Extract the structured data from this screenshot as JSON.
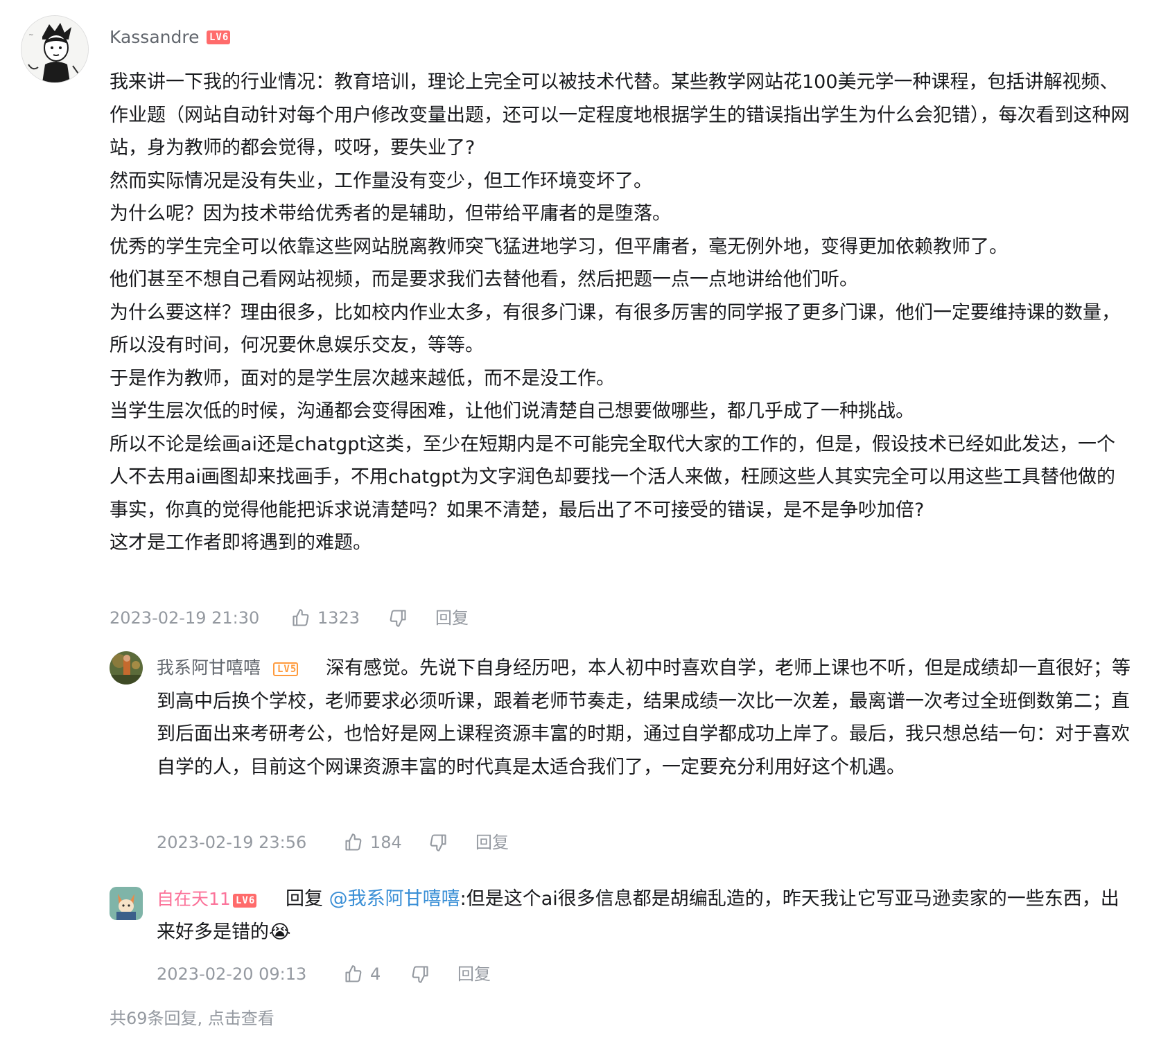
{
  "comments": [
    {
      "user": "Kassandre",
      "level": "LV6",
      "name_color": "#61666d",
      "paragraphs": [
        "我来讲一下我的行业情况：教育培训，理论上完全可以被技术代替。某些教学网站花100美元学一种课程，包括讲解视频、作业题（网站自动针对每个用户修改变量出题，还可以一定程度地根据学生的错误指出学生为什么会犯错），每次看到这种网站，身为教师的都会觉得，哎呀，要失业了?",
        "然而实际情况是没有失业，工作量没有变少，但工作环境变坏了。",
        "为什么呢？因为技术带给优秀者的是辅助，但带给平庸者的是堕落。",
        "优秀的学生完全可以依靠这些网站脱离教师突飞猛进地学习，但平庸者，毫无例外地，变得更加依赖教师了。",
        "他们甚至不想自己看网站视频，而是要求我们去替他看，然后把题一点一点地讲给他们听。",
        "为什么要这样？理由很多，比如校内作业太多，有很多门课，有很多厉害的同学报了更多门课，他们一定要维持课的数量，所以没有时间，何况要休息娱乐交友，等等。",
        "于是作为教师，面对的是学生层次越来越低，而不是没工作。",
        "当学生层次低的时候，沟通都会变得困难，让他们说清楚自己想要做哪些，都几乎成了一种挑战。",
        "所以不论是绘画ai还是chatgpt这类，至少在短期内是不可能完全取代大家的工作的，但是，假设技术已经如此发达，一个人不去用ai画图却来找画手，不用chatgpt为文字润色却要找一个活人来做，枉顾这些人其实完全可以用这些工具替他做的事实，你真的觉得他能把诉求说清楚吗？如果不清楚，最后出了不可接受的错误，是不是争吵加倍?",
        "这才是工作者即将遇到的难题。"
      ],
      "time": "2023-02-19 21:30",
      "likes": "1323",
      "reply_label": "回复"
    },
    {
      "user": "我系阿甘嘻嘻",
      "level": "LV5",
      "name_color": "#61666d",
      "text": "深有感觉。先说下自身经历吧，本人初中时喜欢自学，老师上课也不听，但是成绩却一直很好；等到高中后换个学校，老师要求必须听课，跟着老师节奏走，结果成绩一次比一次差，最离谱一次考过全班倒数第二；直到后面出来考研考公，也恰好是网上课程资源丰富的时期，通过自学都成功上岸了。最后，我只想总结一句：对于喜欢自学的人，目前这个网课资源丰富的时代真是太适合我们了，一定要充分利用好这个机遇。",
      "time": "2023-02-19 23:56",
      "likes": "184",
      "reply_label": "回复"
    },
    {
      "user": "自在天11",
      "level": "LV6",
      "name_color": "#fb7299",
      "reply_prefix": "回复",
      "mention": "@我系阿甘嘻嘻",
      "text": ":但是这个ai很多信息都是胡编乱造的，昨天我让它写亚马逊卖家的一些东西，出来好多是错的",
      "emoji": "😭",
      "time": "2023-02-20 09:13",
      "likes": "4",
      "reply_label": "回复"
    }
  ],
  "footer_text": "共69条回复, 点击查看",
  "colors": {
    "meta": "#9499a0",
    "text": "#18191c",
    "mention": "#3a8fd6",
    "lv6": "#ff6b6b",
    "lv5": "#ff9b3e"
  }
}
